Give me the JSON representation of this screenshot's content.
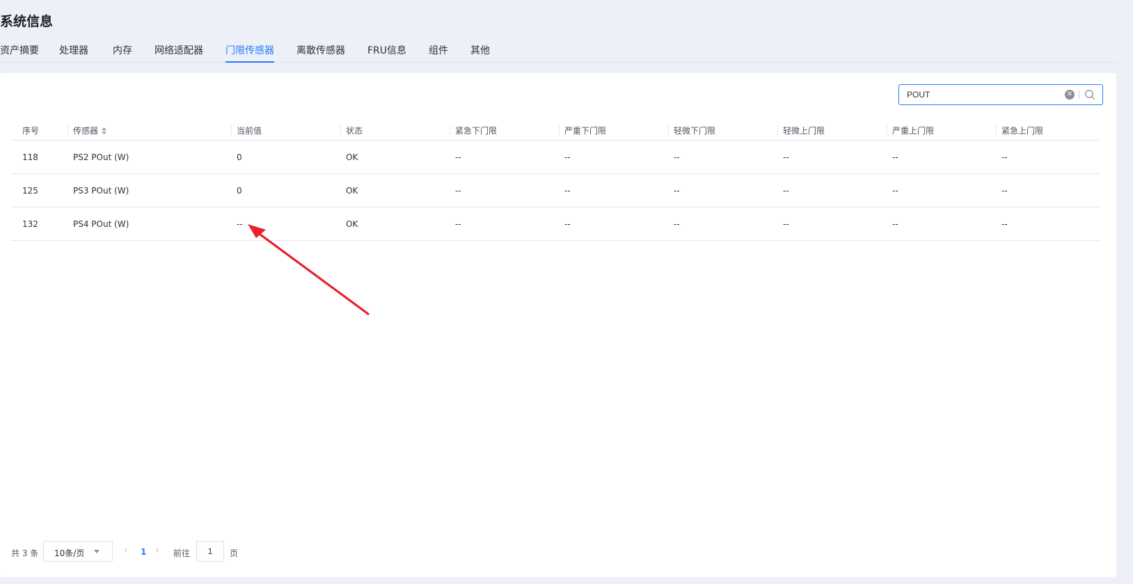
{
  "page": {
    "title": "系统信息"
  },
  "tabs": [
    {
      "label": "资产摘要"
    },
    {
      "label": "处理器"
    },
    {
      "label": "内存"
    },
    {
      "label": "网络适配器"
    },
    {
      "label": "门限传感器",
      "active": true
    },
    {
      "label": "离散传感器"
    },
    {
      "label": "FRU信息"
    },
    {
      "label": "组件"
    },
    {
      "label": "其他"
    }
  ],
  "search": {
    "value": "POUT",
    "clear_icon": "clear-icon",
    "search_icon": "search-icon"
  },
  "table": {
    "columns": [
      "序号",
      "传感器",
      "当前值",
      "状态",
      "紧急下门限",
      "严重下门限",
      "轻微下门限",
      "轻微上门限",
      "严重上门限",
      "紧急上门限"
    ],
    "sortable_column": "传感器",
    "rows": [
      [
        "118",
        "PS2 POut (W)",
        "0",
        "OK",
        "--",
        "--",
        "--",
        "--",
        "--",
        "--"
      ],
      [
        "125",
        "PS3 POut (W)",
        "0",
        "OK",
        "--",
        "--",
        "--",
        "--",
        "--",
        "--"
      ],
      [
        "132",
        "PS4 POut (W)",
        "--",
        "OK",
        "--",
        "--",
        "--",
        "--",
        "--",
        "--"
      ]
    ]
  },
  "pagination": {
    "total": "共 3 条",
    "page_size": "10条/页",
    "current_page": "1",
    "goto_label": "前往",
    "goto_value": "1",
    "page_suffix": "页"
  },
  "colors": {
    "accent": "#2979ff",
    "annotation": "#e8212b",
    "background": "#edf1f7"
  }
}
